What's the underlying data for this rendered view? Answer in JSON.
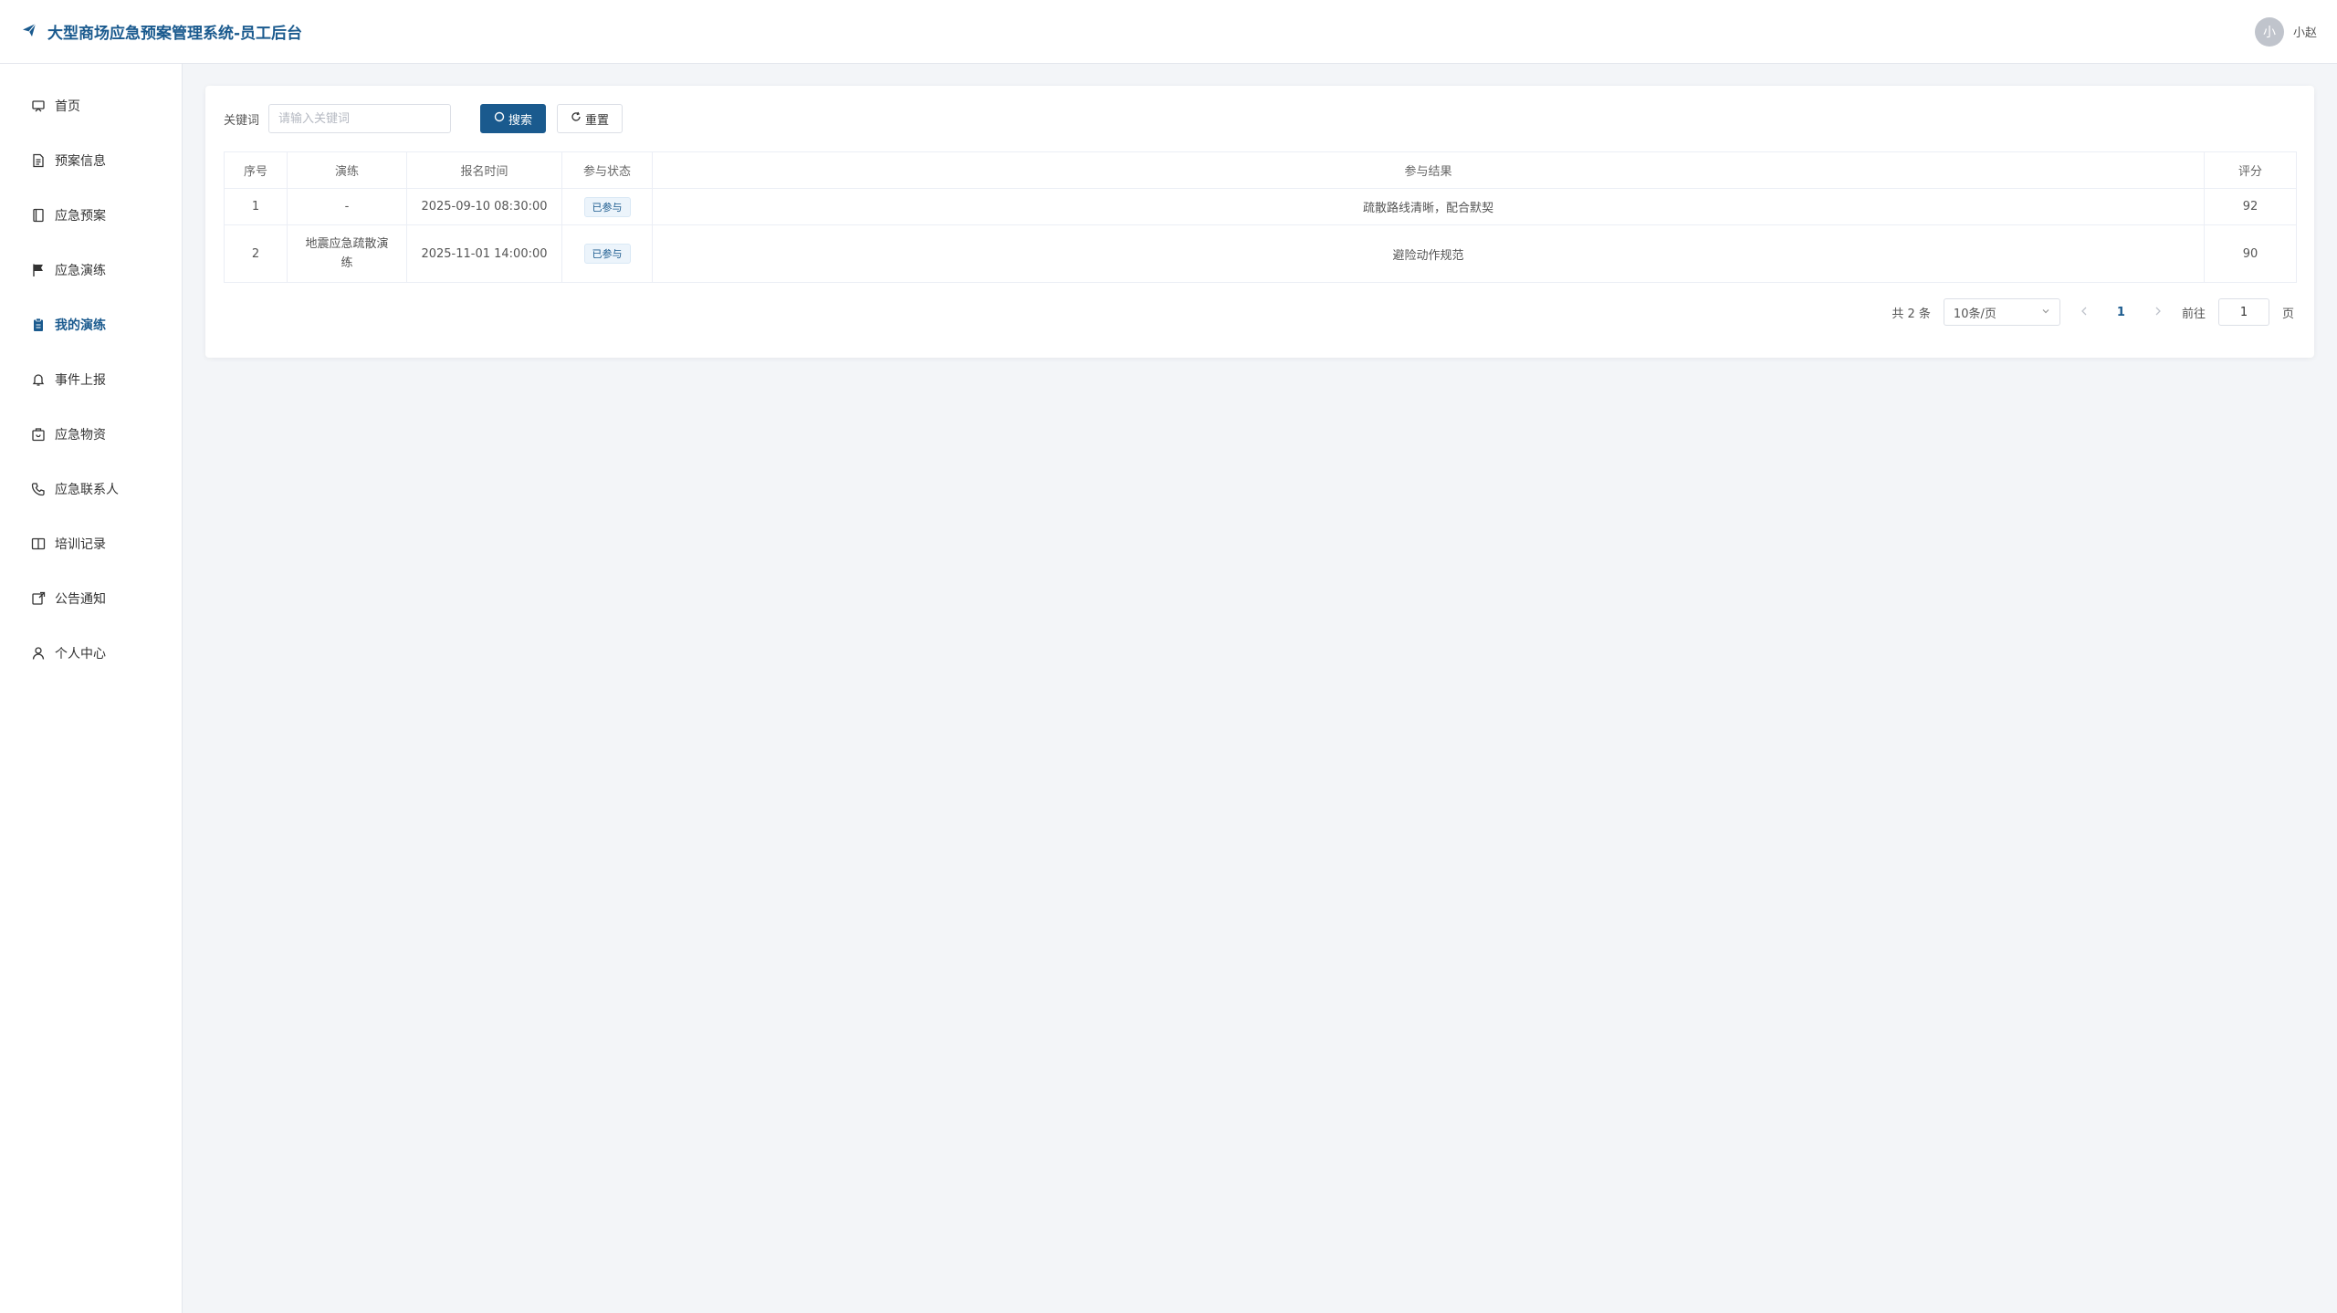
{
  "header": {
    "title": "大型商场应急预案管理系统-员工后台",
    "user_avatar_text": "小",
    "user_name": "小赵"
  },
  "sidebar": {
    "items": [
      {
        "label": "首页",
        "icon": "home-icon"
      },
      {
        "label": "预案信息",
        "icon": "document-icon"
      },
      {
        "label": "应急预案",
        "icon": "book-icon"
      },
      {
        "label": "应急演练",
        "icon": "flag-icon"
      },
      {
        "label": "我的演练",
        "icon": "clipboard-icon",
        "active": true
      },
      {
        "label": "事件上报",
        "icon": "bell-icon"
      },
      {
        "label": "应急物资",
        "icon": "package-icon"
      },
      {
        "label": "应急联系人",
        "icon": "phone-icon"
      },
      {
        "label": "培训记录",
        "icon": "open-book-icon"
      },
      {
        "label": "公告通知",
        "icon": "notice-icon"
      },
      {
        "label": "个人中心",
        "icon": "user-icon"
      }
    ]
  },
  "search": {
    "label": "关键词",
    "placeholder": "请输入关键词",
    "value": "",
    "search_button": "搜索",
    "reset_button": "重置"
  },
  "table": {
    "columns": [
      "序号",
      "演练",
      "报名时间",
      "参与状态",
      "参与结果",
      "评分"
    ],
    "rows": [
      {
        "index": "1",
        "drill": "-",
        "signup_time": "2025-09-10 08:30:00",
        "status": "已参与",
        "result": "疏散路线清晰，配合默契",
        "score": "92"
      },
      {
        "index": "2",
        "drill": "地震应急疏散演练",
        "signup_time": "2025-11-01 14:00:00",
        "status": "已参与",
        "result": "避险动作规范",
        "score": "90"
      }
    ]
  },
  "pagination": {
    "total": "共 2 条",
    "page_size": "10条/页",
    "current_page": "1",
    "goto_label": "前往",
    "goto_value": "1",
    "page_suffix": "页"
  },
  "colors": {
    "accent": "#1a5a8e",
    "background": "#f3f5f8"
  }
}
